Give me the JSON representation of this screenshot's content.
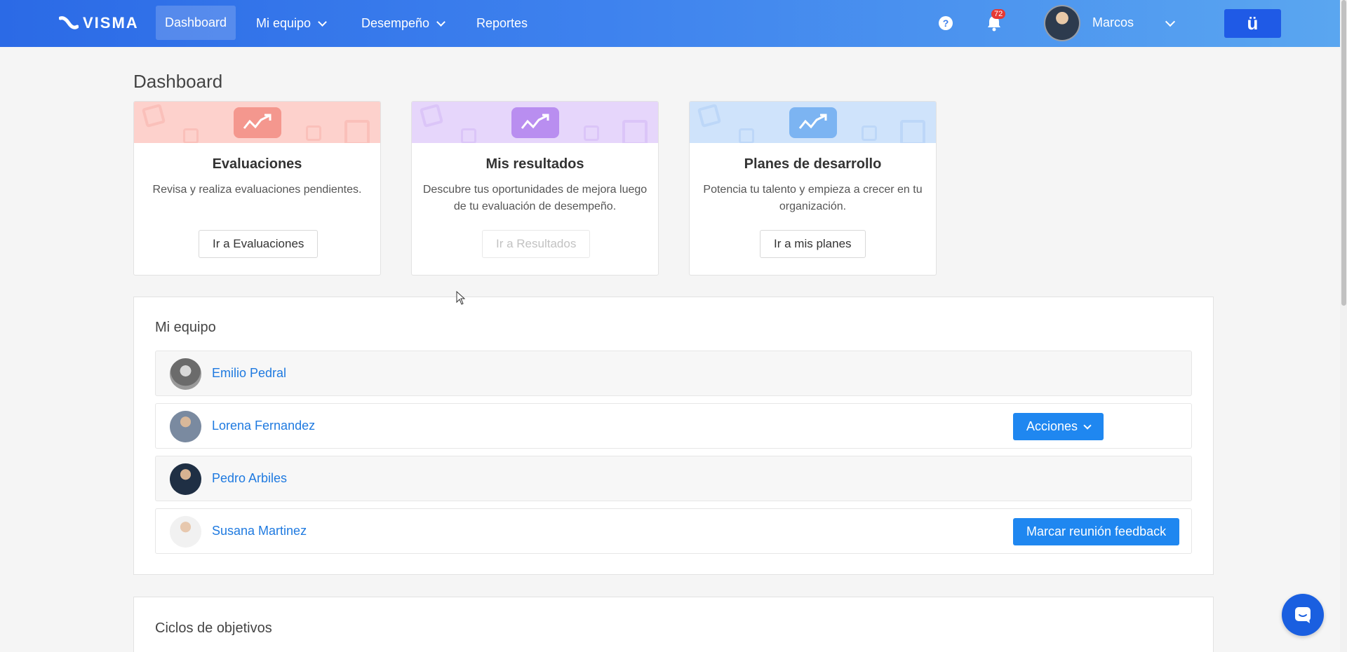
{
  "nav": {
    "logo_text": "VISMA",
    "items": [
      {
        "label": "Dashboard",
        "active": true
      },
      {
        "label": "Mi equipo",
        "dropdown": true
      },
      {
        "label": "Desempeño",
        "dropdown": true
      },
      {
        "label": "Reportes"
      }
    ],
    "help_icon": "question-circle-icon",
    "notification_count": "72",
    "user_name": "Marcos",
    "brand_button_label": "ü"
  },
  "page": {
    "title": "Dashboard"
  },
  "cards": [
    {
      "title": "Evaluaciones",
      "description": "Revisa y realiza evaluaciones pendientes.",
      "button_label": "Ir a Evaluaciones",
      "button_disabled": false,
      "banner_color": "#fdd1cc",
      "icon_color": "#f4978e"
    },
    {
      "title": "Mis resultados",
      "description": "Descubre tus oportunidades de mejora luego de tu evaluación de desempeño.",
      "button_label": "Ir a Resultados",
      "button_disabled": true,
      "banner_color": "#e6d6fb",
      "icon_color": "#b98ef0"
    },
    {
      "title": "Planes de desarrollo",
      "description": "Potencia tu talento y empieza a crecer en tu organización.",
      "button_label": "Ir a mis planes",
      "button_disabled": false,
      "banner_color": "#cfe3fb",
      "icon_color": "#7cb4f2"
    }
  ],
  "team": {
    "title": "Mi equipo",
    "members": [
      {
        "name": "Emilio Pedral",
        "action_label": ""
      },
      {
        "name": "Lorena Fernandez",
        "action_label": "Acciones"
      },
      {
        "name": "Pedro Arbiles",
        "action_label": ""
      },
      {
        "name": "Susana Martinez",
        "action_label": "Marcar reunión feedback"
      }
    ]
  },
  "objectives": {
    "title": "Ciclos de objetivos"
  },
  "colors": {
    "nav_gradient_start": "#2b6ae6",
    "nav_gradient_end": "#5aa6f0",
    "primary_button": "#1f87f0",
    "link": "#1f7ae0"
  }
}
